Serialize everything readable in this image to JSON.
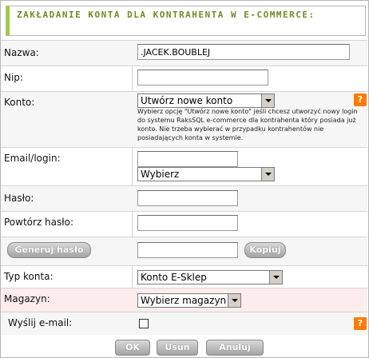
{
  "header": {
    "title": "ZAKŁADANIE KONTA DLA KONTRAHENTA W E-COMMERCE:"
  },
  "form": {
    "nazwa": {
      "label": "Nazwa:",
      "value": ".JACEK.BOUBLEJ"
    },
    "nip": {
      "label": "Nip:",
      "value": ""
    },
    "konto": {
      "label": "Konto:",
      "selected": "Utwórz nowe konto",
      "hint": "Wybierz opcję \"Utwórz nowe konto\" jeśli chcesz utworzyć nowy login do systemu RaksSQL e-commerce dla kontrahenta który posiada już konto. Nie trzeba wybierać w przypadku kontrahentów nie posiadających konta w systemie."
    },
    "email": {
      "label": "Email/login:",
      "value": "",
      "select": "Wybierz"
    },
    "haslo": {
      "label": "Hasło:",
      "value": ""
    },
    "powtorz": {
      "label": "Powtórz hasło:",
      "value": ""
    },
    "generuj": {
      "button": "Generuj hasło",
      "value": "",
      "copy_button": "Kopiuj"
    },
    "typ_konta": {
      "label": "Typ konta:",
      "selected": "Konto E-Sklep"
    },
    "magazyn": {
      "label": "Magazyn:",
      "selected": "Wybierz magazyn"
    },
    "wyslij": {
      "label": "Wyślij e-mail:",
      "checked": false
    }
  },
  "help_glyph": "?",
  "actions": {
    "ok": "OK",
    "usun": "Usuń",
    "anuluj": "Anuluj"
  },
  "colors": {
    "accent": "#9acd32",
    "title": "#6b8e23",
    "help": "#ff7b00",
    "pink_row": "#fcecec"
  }
}
